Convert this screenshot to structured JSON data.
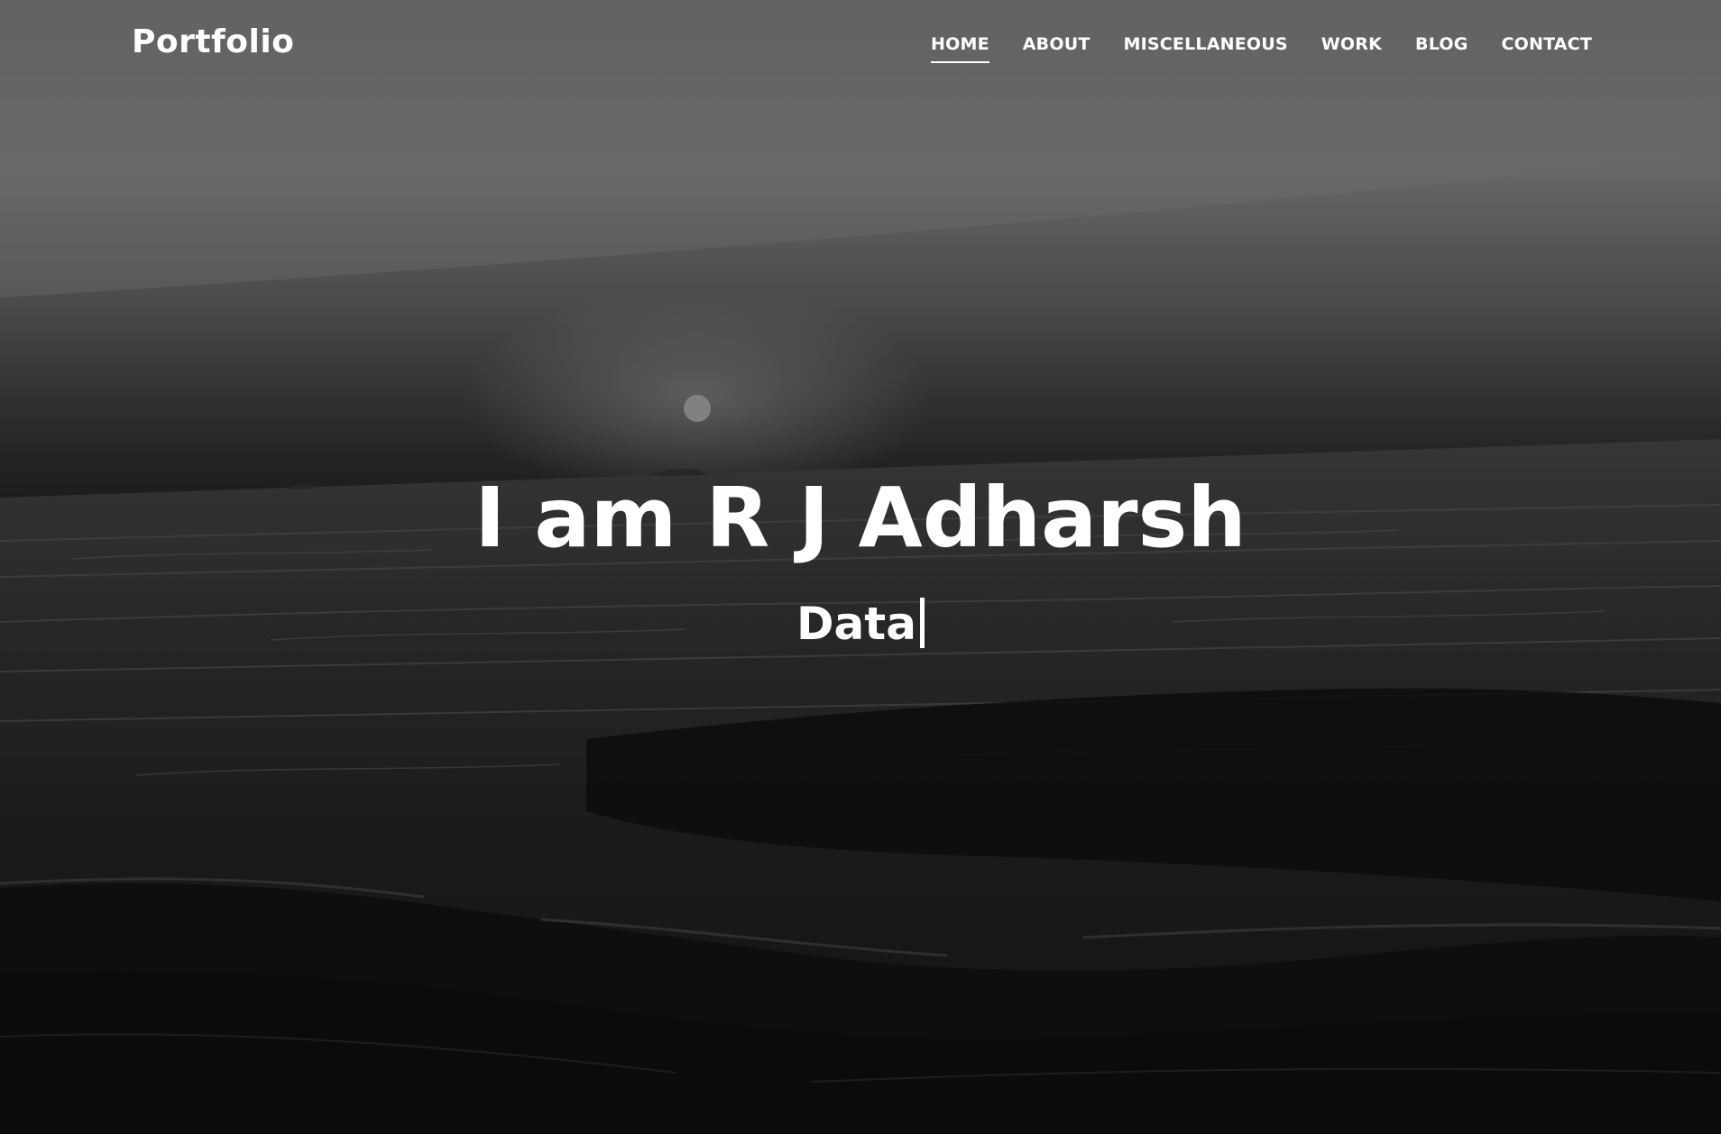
{
  "nav": {
    "brand": "Portfolio",
    "links": [
      {
        "label": "HOME",
        "active": true
      },
      {
        "label": "ABOUT",
        "active": false
      },
      {
        "label": "MISCELLANEOUS",
        "active": false
      },
      {
        "label": "WORK",
        "active": false
      },
      {
        "label": "BLOG",
        "active": false
      },
      {
        "label": "CONTACT",
        "active": false
      }
    ]
  },
  "hero": {
    "headline": "I am R J Adharsh",
    "typed_text": "Data",
    "background": "grayscale photo of ocean waves at sunset"
  },
  "colors": {
    "text": "#ffffff",
    "sky_top": "#6e6e6e",
    "horizon": "#3a3a3a",
    "sea_dark": "#0d0d0d"
  }
}
